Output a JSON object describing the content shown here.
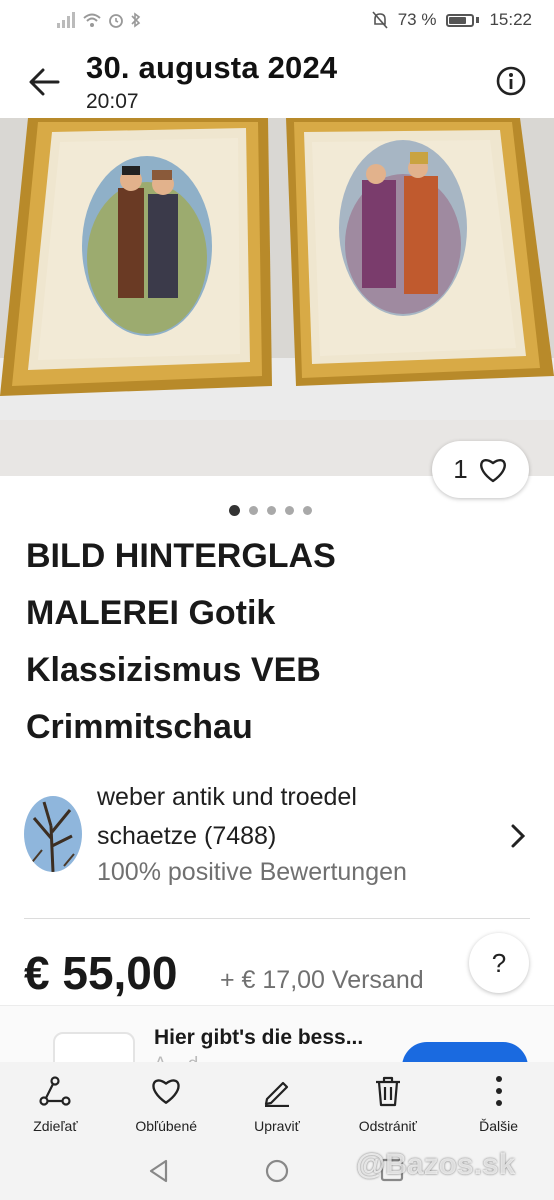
{
  "status_bar": {
    "battery": "73 %",
    "time": "15:22"
  },
  "header": {
    "title": "30. augusta 2024",
    "subtitle": "20:07"
  },
  "listing": {
    "likes": "1",
    "title_lines": [
      "BILD HINTERGLAS",
      "MALEREI Gotik",
      "Klassizismus VEB",
      "Crimmitschau"
    ],
    "image_count": 5,
    "image_index": 1
  },
  "seller": {
    "name_line1": "weber antik und troedel",
    "name_line2": "schaetze (7488)",
    "rating": "100% positive Bewertungen"
  },
  "price": {
    "amount": "€ 55,00",
    "shipping": "+ € 17,00 Versand",
    "help": "?"
  },
  "ad": {
    "text": "Hier gibt's die bess...",
    "sub": "A... d..."
  },
  "toolbar": {
    "items": [
      {
        "label": "Zdieľať",
        "icon": "share-icon"
      },
      {
        "label": "Obľúbené",
        "icon": "heart-icon"
      },
      {
        "label": "Upraviť",
        "icon": "edit-icon"
      },
      {
        "label": "Odstrániť",
        "icon": "trash-icon"
      },
      {
        "label": "Ďalšie",
        "icon": "more-vertical-icon"
      }
    ]
  },
  "watermark": "@Bazos.sk",
  "colors": {
    "accent": "#1a6ae0",
    "text": "#191919",
    "muted": "#707070"
  }
}
